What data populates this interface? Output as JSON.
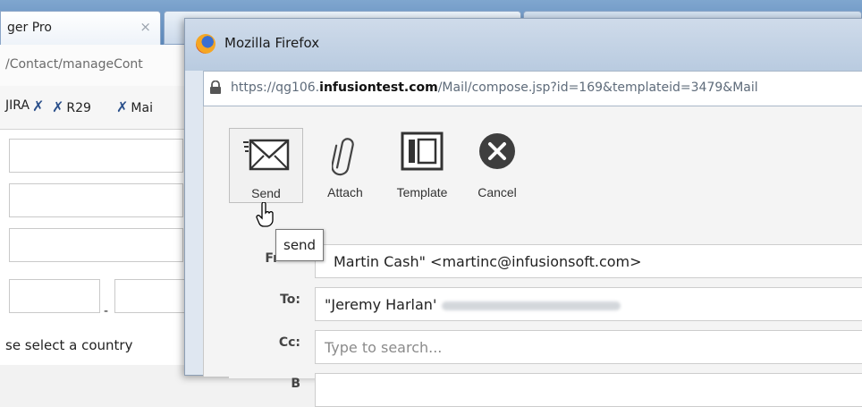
{
  "background_window": {
    "tab_title": "ger Pro",
    "tab_close": "×",
    "url_fragment": "/Contact/manageCont",
    "bookmarks": [
      {
        "icon": "tools-icon",
        "label": "JIRA"
      },
      {
        "icon": "tools-icon",
        "label": "R29"
      },
      {
        "icon": "tools-icon",
        "label": "Mai"
      }
    ],
    "phone_separator": "-",
    "country_placeholder": "se select a country"
  },
  "popup": {
    "title": "Mozilla Firefox",
    "url_prefix": "https://qg106.",
    "url_domain": "infusiontest.com",
    "url_suffix": "/Mail/compose.jsp?id=169&templateid=3479&Mail",
    "toolbar": {
      "send_label": "Send",
      "attach_label": "Attach",
      "template_label": "Template",
      "cancel_label": "Cancel"
    },
    "tooltip": "send",
    "from": {
      "label": "Fr",
      "value": "Martin Cash\" <martinc@infusionsoft.com>"
    },
    "to": {
      "label": "To:",
      "value": "\"Jeremy Harlan'"
    },
    "cc": {
      "label": "Cc:",
      "placeholder": "Type to search..."
    },
    "bcc": {
      "label": "B"
    }
  },
  "colors": {
    "tab_bar": "#5b86b8",
    "cancel_button": "#3e3e3e",
    "field_border": "#cdcdcd"
  }
}
